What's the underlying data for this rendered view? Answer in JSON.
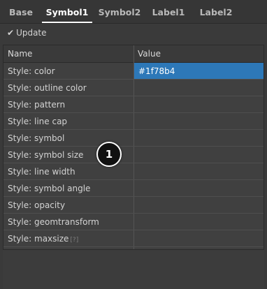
{
  "tabs": [
    {
      "label": "Base",
      "active": false
    },
    {
      "label": "Symbol1",
      "active": true
    },
    {
      "label": "Symbol2",
      "active": false
    },
    {
      "label": "Label1",
      "active": false
    },
    {
      "label": "Label2",
      "active": false
    }
  ],
  "toolbar": {
    "update_label": "Update",
    "update_icon": "check-icon"
  },
  "grid": {
    "columns": {
      "name": "Name",
      "value": "Value"
    },
    "rows": [
      {
        "name": "Style: color",
        "value": "#1f78b4"
      },
      {
        "name": "Style: outline color",
        "value": ""
      },
      {
        "name": "Style: pattern",
        "value": ""
      },
      {
        "name": "Style: line cap",
        "value": ""
      },
      {
        "name": "Style: symbol",
        "value": ""
      },
      {
        "name": "Style: symbol size",
        "value": ""
      },
      {
        "name": "Style: line width",
        "value": ""
      },
      {
        "name": "Style: symbol angle",
        "value": ""
      },
      {
        "name": "Style: opacity",
        "value": ""
      },
      {
        "name": "Style: geomtransform",
        "value": ""
      },
      {
        "name": "Style: maxsize",
        "value": "",
        "help": "[?]"
      }
    ]
  },
  "annotation": {
    "number": "1"
  },
  "colors": {
    "selected_value_bg": "#2d78b8",
    "background": "#3a3a3a"
  }
}
